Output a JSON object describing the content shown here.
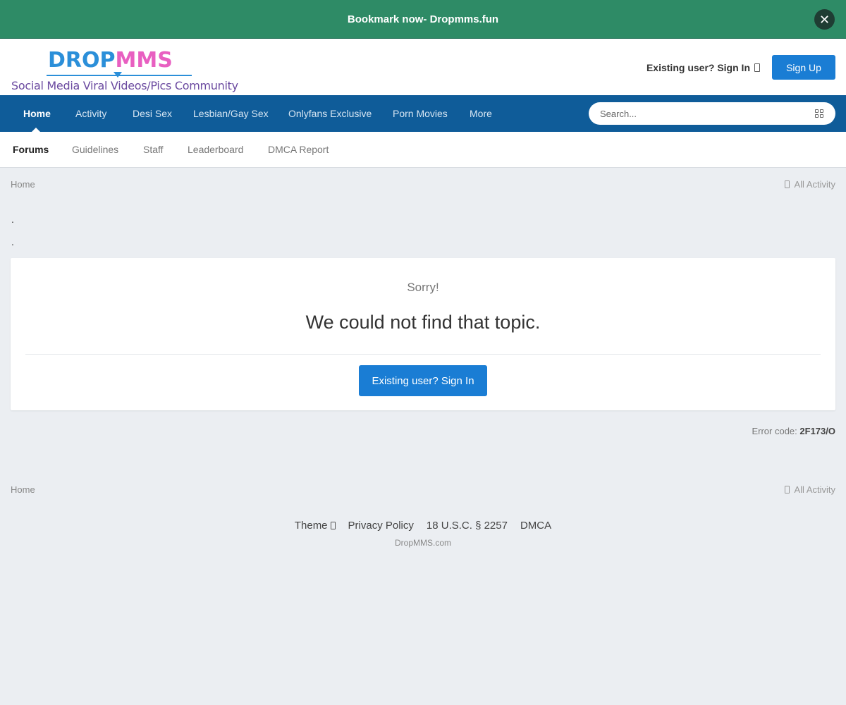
{
  "announcement": {
    "text": "Bookmark now- Dropmms.fun",
    "close_icon": "✕"
  },
  "header": {
    "logo": {
      "word_part1": "DROP",
      "word_part2": "MMS",
      "tagline": "Social Media Viral Videos/Pics Community"
    },
    "signin_label": "Existing user? Sign In",
    "signup_label": "Sign Up"
  },
  "nav": {
    "items": [
      {
        "label": "Home",
        "active": true
      },
      {
        "label": "Activity"
      },
      {
        "label": "Desi Sex"
      },
      {
        "label": "Lesbian/Gay Sex"
      },
      {
        "label": "Onlyfans Exclusive"
      },
      {
        "label": "Porn Movies"
      },
      {
        "label": "More"
      }
    ],
    "search_placeholder": "Search..."
  },
  "subnav": {
    "items": [
      {
        "label": "Forums",
        "active": true
      },
      {
        "label": "Guidelines"
      },
      {
        "label": "Staff"
      },
      {
        "label": "Leaderboard"
      },
      {
        "label": "DMCA Report"
      }
    ]
  },
  "breadcrumb": {
    "home": "Home",
    "all_activity": "All Activity"
  },
  "dots": [
    ".",
    "."
  ],
  "error": {
    "sorry": "Sorry!",
    "message": "We could not find that topic.",
    "signin_button": "Existing user? Sign In",
    "code_label": "Error code:",
    "code": "2F173/O"
  },
  "footer": {
    "breadcrumb_home": "Home",
    "all_activity": "All Activity",
    "links": [
      "Theme",
      "Privacy Policy",
      "18 U.S.C. § 2257",
      "DMCA"
    ],
    "copyright": "DropMMS.com"
  },
  "colors": {
    "announcement_bg": "#2e8b66",
    "nav_bg": "#0f5c99",
    "primary_button": "#1a7dd4",
    "page_bg": "#ebeef2"
  }
}
